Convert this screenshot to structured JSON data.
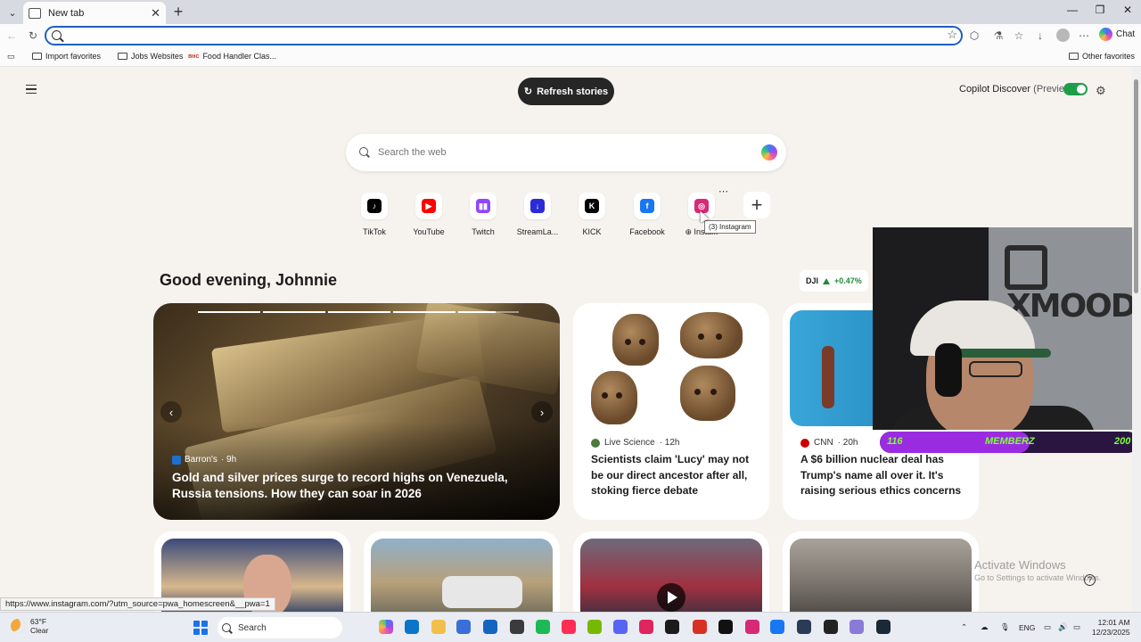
{
  "browser": {
    "tab_title": "New tab",
    "address_value": "",
    "chat_label": "Chat",
    "favorites": [
      {
        "label": "Import favorites"
      },
      {
        "label": "Jobs Websites"
      },
      {
        "label": "Food Handler Clas..."
      }
    ],
    "other_favorites": "Other favorites"
  },
  "page": {
    "refresh_label": "Refresh stories",
    "copilot_discover_label": "Copilot Discover",
    "copilot_discover_preview": "(Preview)",
    "search_placeholder": "Search the web",
    "greeting": "Good evening, Johnnie",
    "ticker": {
      "symbol": "DJI",
      "change": "+0.47%"
    },
    "quick_links": [
      {
        "label": "TikTok",
        "glyph": "♪",
        "color": "#000000"
      },
      {
        "label": "YouTube",
        "glyph": "▶",
        "color": "#ff0000"
      },
      {
        "label": "Twitch",
        "glyph": "▮▮",
        "color": "#9146ff"
      },
      {
        "label": "StreamLa...",
        "glyph": "↓",
        "color": "#2b2bd8"
      },
      {
        "label": "KICK",
        "glyph": "K",
        "color": "#000000"
      },
      {
        "label": "Facebook",
        "glyph": "f",
        "color": "#1877f2"
      },
      {
        "label": "⊕ Insta...",
        "glyph": "◎",
        "color": "#d62976"
      }
    ],
    "tooltip": "(3) Instagram",
    "hero": {
      "source": "Barron's",
      "age": "· 9h",
      "title": "Gold and silver prices surge to record highs on Venezuela, Russia tensions. How they can soar in 2026"
    },
    "cards": [
      {
        "source": "Live Science",
        "age": "· 12h",
        "title": "Scientists claim 'Lucy' may not be our direct ancestor after all, stoking fierce debate"
      },
      {
        "source": "CNN",
        "age": "· 20h",
        "title": "A $6 billion nuclear deal has Trump's name all over it. It's raising serious ethics concerns"
      }
    ],
    "status_url": "https://www.instagram.com/?utm_source=pwa_homescreen&__pwa=1",
    "activate_windows": "Activate Windows",
    "activate_hint": "Go to Settings to activate Windows."
  },
  "webcam": {
    "brand_text": "XMOOD",
    "sub_left": "116",
    "sub_mid": "MEMBERZ",
    "sub_right": "200",
    "sub_progress": 0.58
  },
  "taskbar": {
    "temp": "63°F",
    "condition": "Clear",
    "search_label": "Search",
    "language": "ENG",
    "time": "12:01 AM",
    "date": "12/23/2025"
  }
}
